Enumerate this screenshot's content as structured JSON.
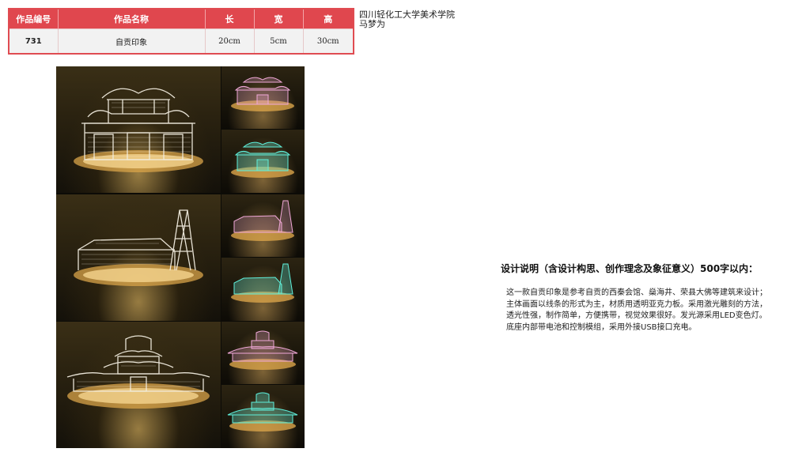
{
  "table": {
    "headers": [
      "作品编号",
      "作品名称",
      "长",
      "宽",
      "高"
    ],
    "row": [
      "731",
      "自贡印象",
      "20cm",
      "5cm",
      "30cm"
    ]
  },
  "author": {
    "school": "四川轻化工大学美术学院",
    "name": "马梦为"
  },
  "description": {
    "title": "设计说明（含设计构思、创作理念及象征意义）500字以内：",
    "lines": [
      "这一款自贡印象是参考自贡的西秦会馆、燊海井、荣县大佛等建筑来设计；",
      "主体画面以线条的形式为主，材质用透明亚克力板。采用激光雕刻的方法，",
      "透光性强，制作简单，方便携带，视觉效果很好。发光源采用LED变色灯。",
      "底座内部带电池和控制模组，采用外接USB接口充电。"
    ]
  },
  "colors": {
    "header_red": "#e0474e",
    "lamp_white": "#f2ede0",
    "lamp_pink": "#f0a8d8",
    "lamp_cyan": "#5ff0dc",
    "base_gold": "#d9a44a"
  },
  "icons": {
    "photo": "acrylic-led-lamp-photos"
  }
}
